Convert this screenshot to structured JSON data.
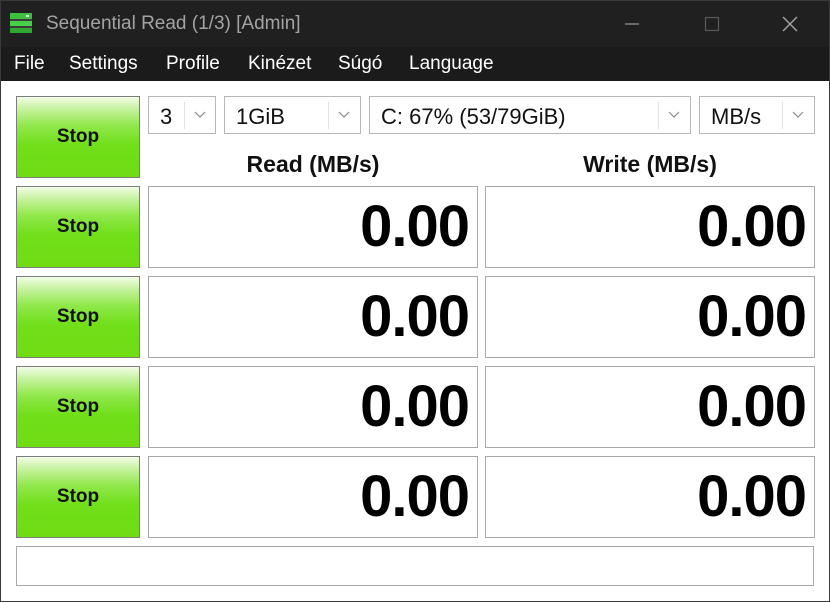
{
  "window": {
    "title": "Sequential Read (1/3) [Admin]"
  },
  "menu": {
    "items": [
      "File",
      "Settings",
      "Profile",
      "Kinézet",
      "Súgó",
      "Language"
    ]
  },
  "toolbar": {
    "count_value": "3",
    "size_value": "1GiB",
    "drive_value": "C: 67% (53/79GiB)",
    "unit_value": "MB/s"
  },
  "headers": {
    "read": "Read (MB/s)",
    "write": "Write (MB/s)"
  },
  "buttons": {
    "stop_label": "Stop"
  },
  "rows": [
    {
      "read": "0.00",
      "write": "0.00"
    },
    {
      "read": "0.00",
      "write": "0.00"
    },
    {
      "read": "0.00",
      "write": "0.00"
    },
    {
      "read": "0.00",
      "write": "0.00"
    }
  ],
  "status": {
    "text": ""
  },
  "colors": {
    "titlebar": "#202020",
    "menubar": "#1b1b1b",
    "stop_green": "#71df19"
  }
}
